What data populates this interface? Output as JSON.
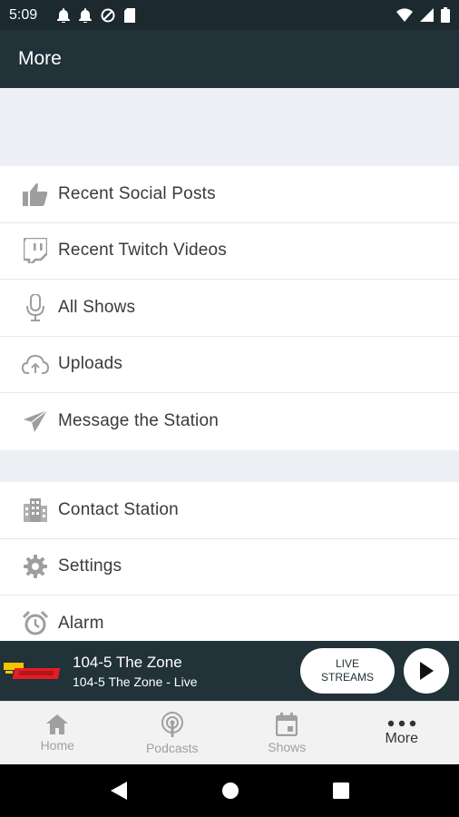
{
  "status": {
    "time": "5:09"
  },
  "header": {
    "title": "More"
  },
  "menu_group_1": [
    {
      "label": "Recent Social Posts",
      "icon": "thumbs-up-icon"
    },
    {
      "label": "Recent Twitch Videos",
      "icon": "twitch-icon"
    },
    {
      "label": "All Shows",
      "icon": "microphone-icon"
    },
    {
      "label": "Uploads",
      "icon": "cloud-upload-icon"
    },
    {
      "label": "Message the Station",
      "icon": "paper-plane-icon"
    }
  ],
  "menu_group_2": [
    {
      "label": "Contact Station",
      "icon": "building-icon"
    },
    {
      "label": "Settings",
      "icon": "gear-icon"
    },
    {
      "label": "Alarm",
      "icon": "alarm-clock-icon"
    }
  ],
  "player": {
    "title": "104-5 The Zone",
    "subtitle": "104-5 The Zone - Live",
    "live_streams_label": "LIVE\nSTREAMS"
  },
  "bottom_nav": [
    {
      "label": "Home",
      "icon": "home-icon"
    },
    {
      "label": "Podcasts",
      "icon": "podcast-icon"
    },
    {
      "label": "Shows",
      "icon": "calendar-icon"
    },
    {
      "label": "More",
      "icon": "more-dots-icon",
      "active": true
    }
  ],
  "colors": {
    "header": "#213238",
    "status_bar": "#1c2a30",
    "icon_gray": "#9e9e9e",
    "logo_accent": "#e31e24"
  }
}
